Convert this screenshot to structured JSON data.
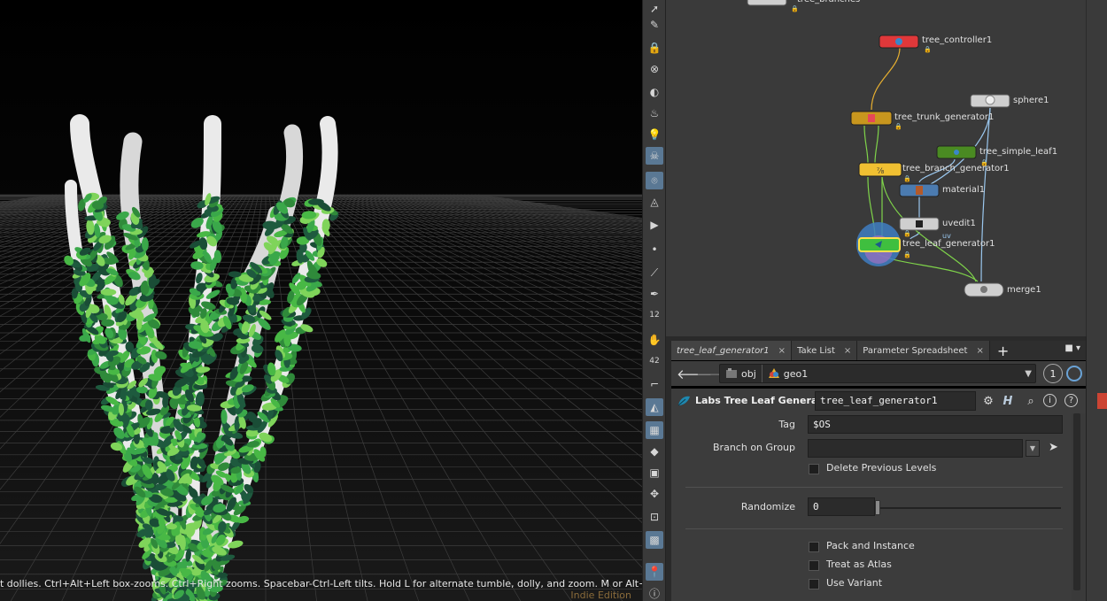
{
  "viewport": {
    "status_text": "t dollies. Ctrl+Alt+Left box-zooms. Ctrl+Right zooms. Spacebar-Ctrl-Left tilts. Hold L for alternate tumble, dolly, and zoom.    M or Alt+M for First",
    "edition": "Indie Edition"
  },
  "tools": [
    {
      "icon": "select-icon"
    },
    {
      "icon": "pose-icon"
    },
    {
      "icon": "lock-icon"
    },
    {
      "icon": "snapshot-icon"
    },
    {
      "icon": "sphere-display-icon"
    },
    {
      "icon": "light-icon"
    },
    {
      "icon": "light-bulb-icon"
    },
    {
      "icon": "skull-icon"
    },
    {
      "icon": "camera-icon"
    },
    {
      "icon": "flipbook-icon"
    },
    {
      "icon": "render-icon"
    },
    {
      "icon": "dot-icon"
    },
    {
      "icon": "brush-icon"
    },
    {
      "icon": "pen-icon"
    },
    {
      "icon": "number-12-icon"
    },
    {
      "icon": "hand-icon"
    },
    {
      "icon": "number-42-icon"
    },
    {
      "icon": "angle-icon"
    },
    {
      "icon": "sculpt-icon"
    },
    {
      "icon": "checker-icon"
    },
    {
      "icon": "diamond-icon"
    },
    {
      "icon": "box-icon"
    },
    {
      "icon": "sweep-icon"
    },
    {
      "icon": "frame-icon"
    },
    {
      "icon": "image-icon"
    },
    {
      "icon": "pin-icon"
    },
    {
      "icon": "info-icon"
    }
  ],
  "tool_labels": {
    "t12": "12",
    "t42": "42"
  },
  "network": {
    "nodes": {
      "partial_top": "tree_branches",
      "tree_controller": "tree_controller1",
      "sphere": "sphere1",
      "trunk": "tree_trunk_generator1",
      "simple_leaf": "tree_simple_leaf1",
      "branch": "tree_branch_generator1",
      "material": "material1",
      "uvedit": "uvedit1",
      "leaf": "tree_leaf_generator1",
      "leaf_badge": "uv",
      "merge": "merge1"
    },
    "colors": {
      "controller": "#e0383a",
      "trunk": "#c8961e",
      "branch": "#f0c032",
      "simple_leaf": "#4a8a22",
      "material": "#4b7bb0",
      "default_node": "#cfcfcf",
      "selected_leaf": "#3fbf3f"
    }
  },
  "tabs": [
    {
      "label": "tree_leaf_generator1",
      "active": true
    },
    {
      "label": "Take List",
      "active": false
    },
    {
      "label": "Parameter Spreadsheet",
      "active": false
    }
  ],
  "tab_close": "×",
  "tab_add": "+",
  "path": {
    "back": "🡐",
    "forward": "🡒",
    "crumb1": "obj",
    "crumb2": "geo1",
    "pin": "1"
  },
  "param_header": {
    "op_type": "Labs Tree Leaf Generator",
    "node_name": "tree_leaf_generator1",
    "help": "?",
    "info": "i",
    "houdini": "H"
  },
  "params": {
    "tag_label": "Tag",
    "tag_value": "$OS",
    "branch_group_label": "Branch on Group",
    "branch_group_value": "",
    "delete_prev_label": "Delete Previous Levels",
    "randomize_label": "Randomize",
    "randomize_value": "0",
    "pack_label": "Pack and Instance",
    "atlas_label": "Treat as Atlas",
    "variant_label": "Use Variant"
  }
}
